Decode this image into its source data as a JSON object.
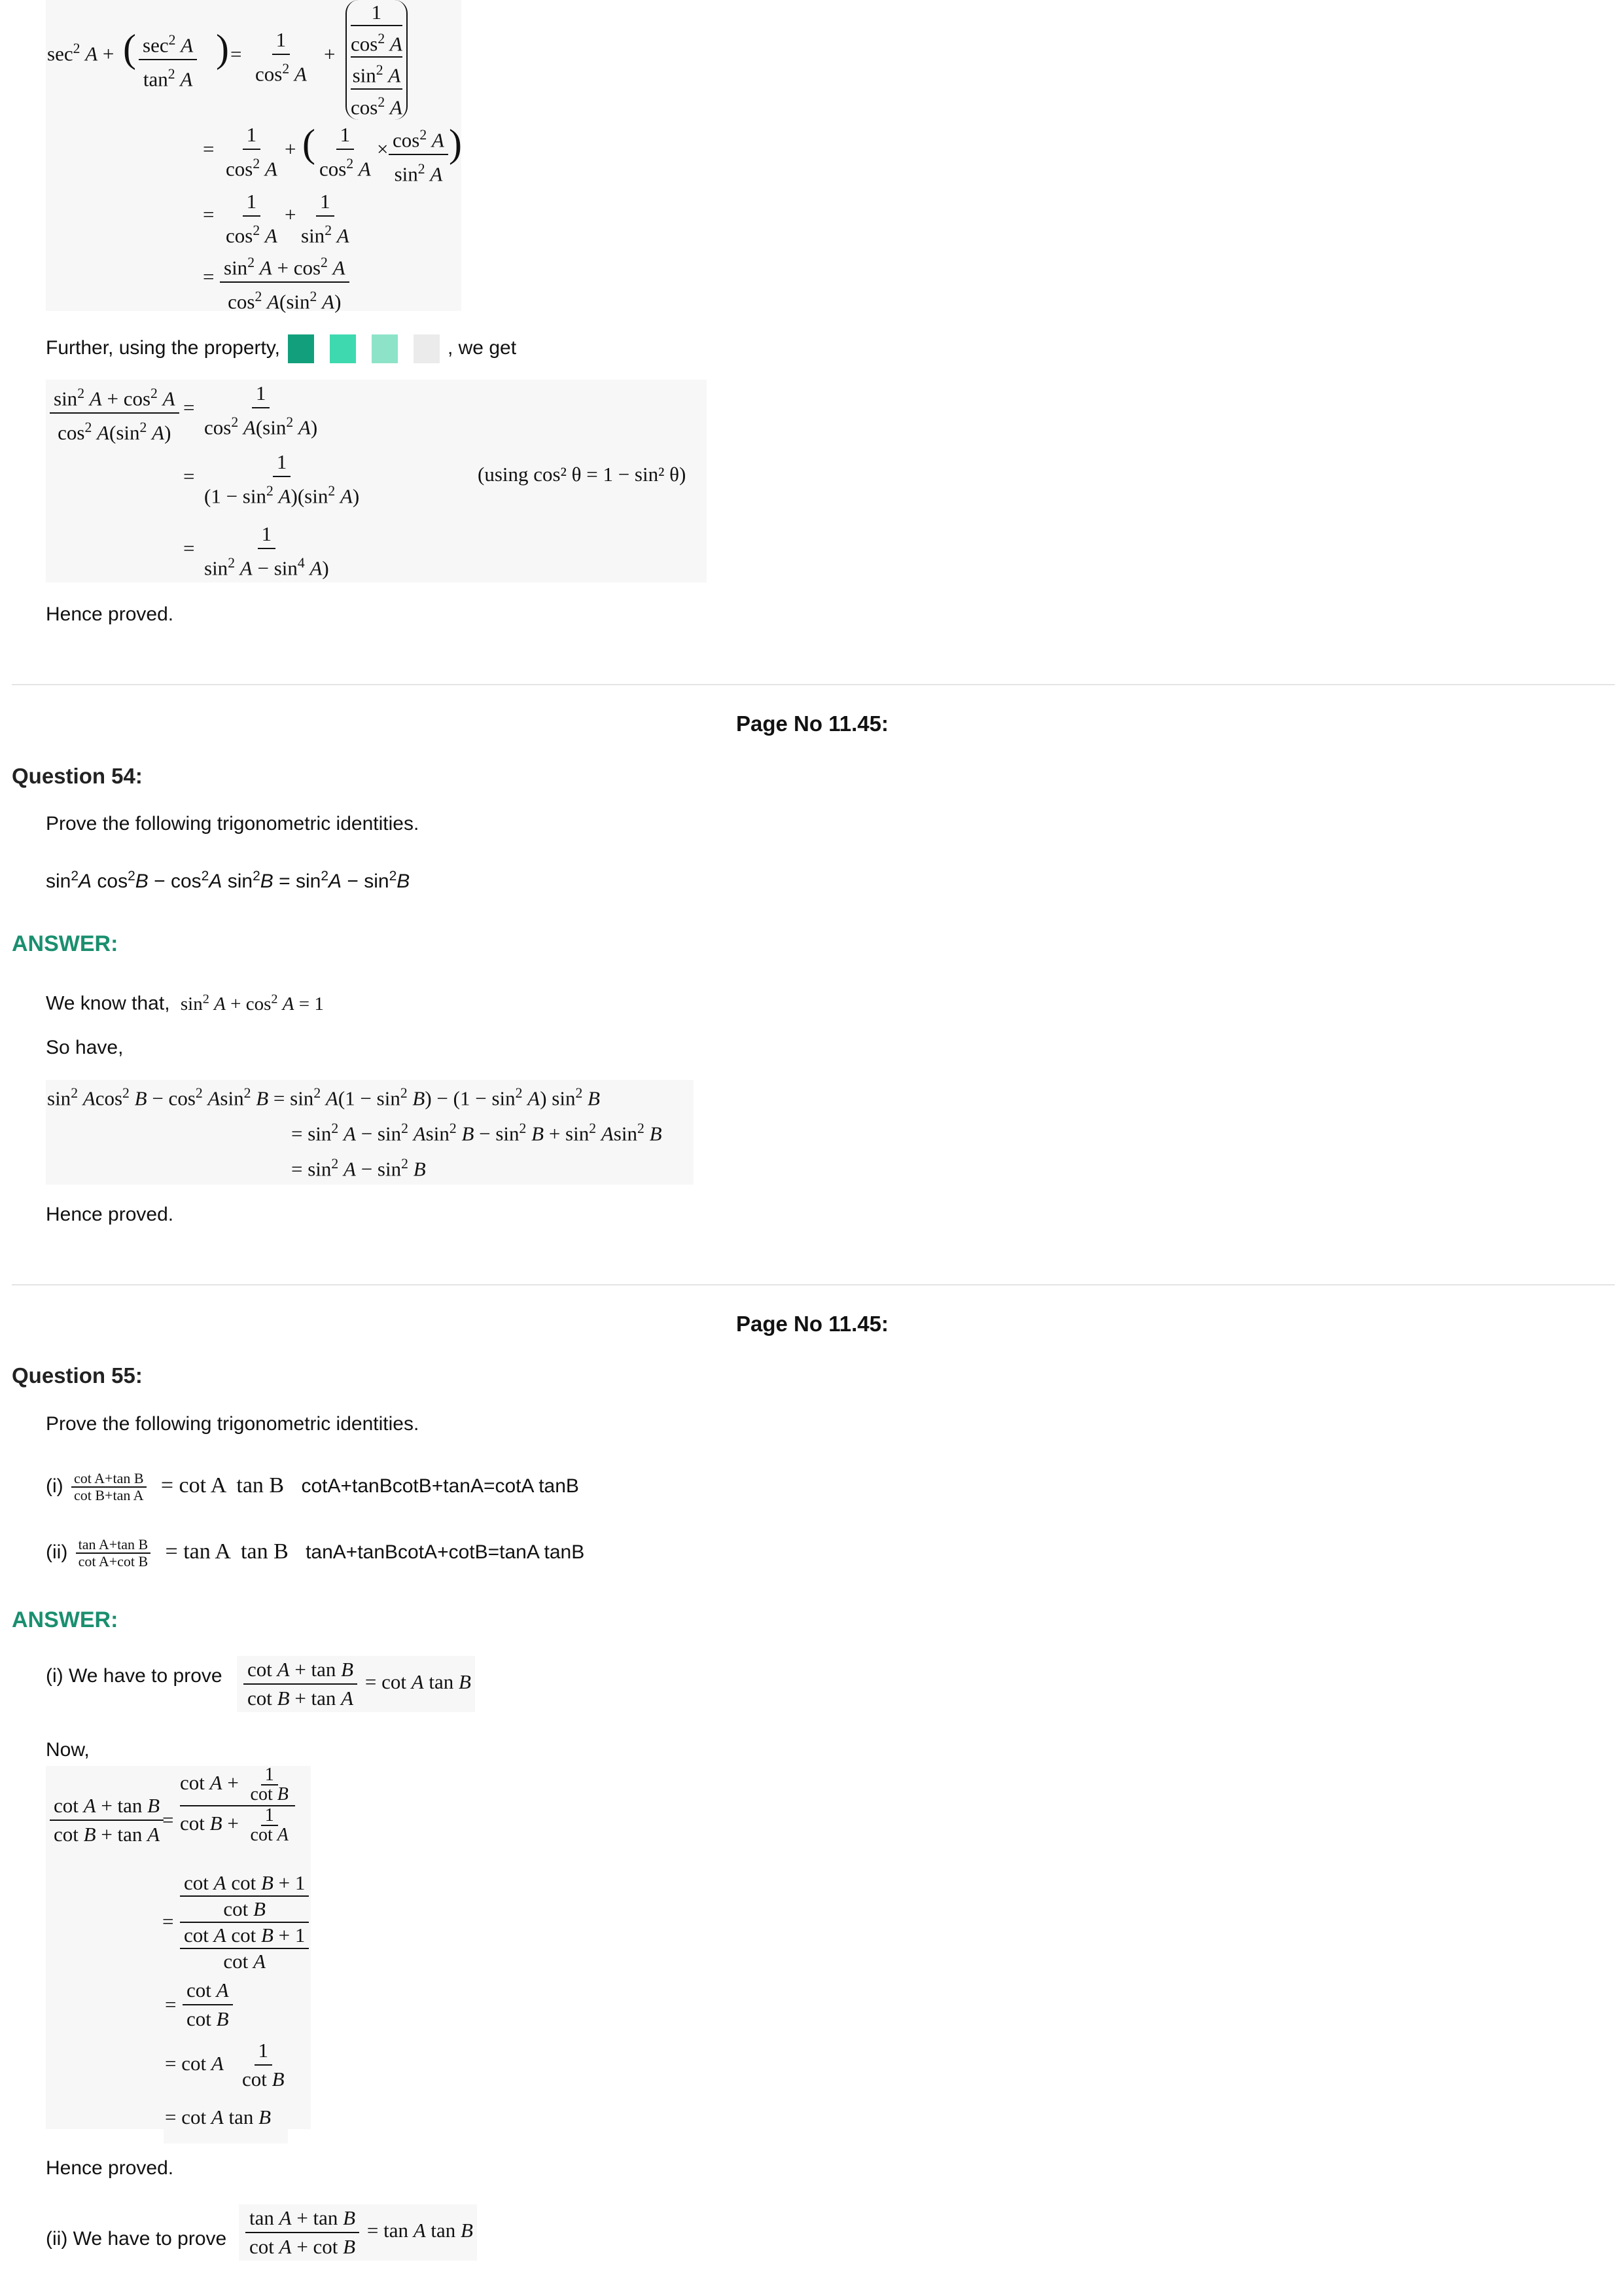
{
  "q53_tail": {
    "further_prefix": "Further, using the property,",
    "further_suffix": ", we get",
    "swatch_colors": [
      "#12a07c",
      "#3fd9b0",
      "#8de3c8",
      "#ebebeb"
    ],
    "hence": "Hence proved.",
    "note": "(using cos² θ = 1 − sin² θ)"
  },
  "sections": [
    {
      "page_no": "Page No 11.45:",
      "question": "Question 54:",
      "prompt": "Prove the following trigonometric identities.",
      "identity": "sin²A cos²B − cos²A sin²B = sin²A − sin²B",
      "answer_label": "ANSWER:",
      "know": "We know that,",
      "know_math": "sin² A + cos² A = 1",
      "so_have": "So have,",
      "hence": "Hence proved."
    },
    {
      "page_no": "Page No 11.45:",
      "question": "Question 55:",
      "prompt": "Prove the following trigonometric identities.",
      "part_i_label": "(i)",
      "part_i_text": "cotA+tanBcotB+tanA=cotA tanB",
      "part_ii_label": "(ii)",
      "part_ii_text": "tanA+tanBcotA+cotB=tanA tanB",
      "answer_label": "ANSWER:",
      "i_prove": "(i) We have to prove",
      "now": "Now,",
      "hence": "Hence proved.",
      "ii_prove": "(ii) We have to prove"
    }
  ]
}
